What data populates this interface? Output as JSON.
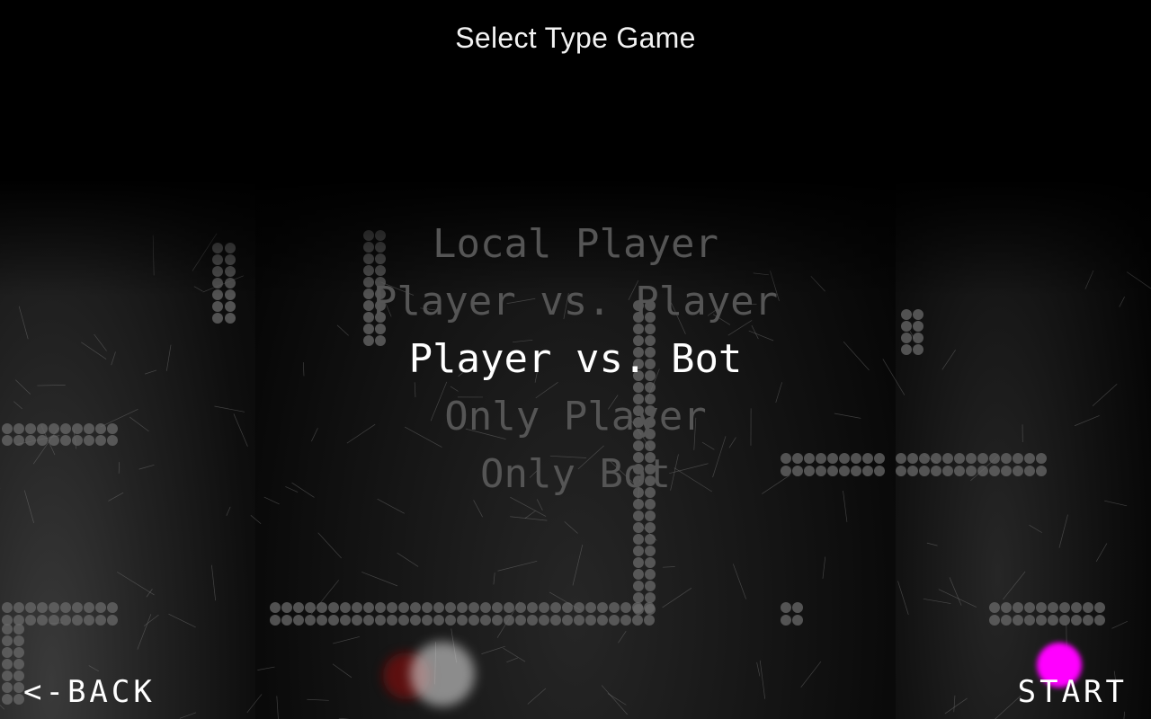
{
  "header": {
    "title": "Select Type Game"
  },
  "menu": {
    "items": [
      {
        "label": "Local Player",
        "selected": false
      },
      {
        "label": "Player vs. Player",
        "selected": false
      },
      {
        "label": "Player vs. Bot",
        "selected": true
      },
      {
        "label": "Only Player",
        "selected": false
      },
      {
        "label": "Only Bot",
        "selected": false
      }
    ]
  },
  "footer": {
    "back_label": "<-BACK",
    "start_label": "START"
  },
  "colors": {
    "background": "#000000",
    "text": "#ffffff",
    "menu_inactive": "#555555",
    "dot": "#6a6a6a",
    "accent_ball": "#ff00ff",
    "bot_ball": "#d8d8d8",
    "bot_trail": "#7a1010"
  }
}
